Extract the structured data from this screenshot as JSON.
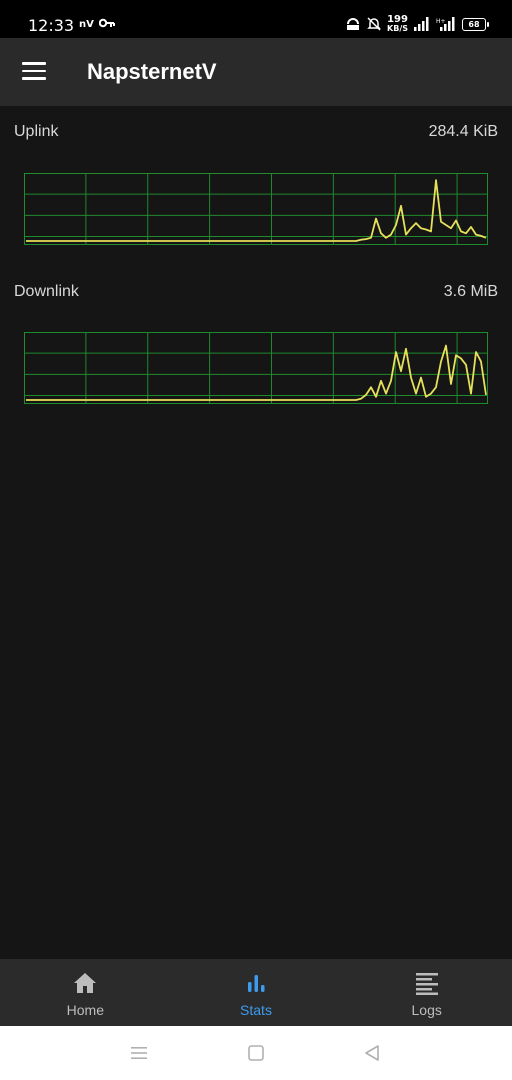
{
  "status_bar": {
    "time": "12:33",
    "nv": "nV",
    "net_speed_value": "199",
    "net_speed_unit": "KB/S",
    "battery": "68",
    "icons": [
      "key-icon",
      "vpn-icon",
      "mute-icon",
      "signal-icon",
      "signal-hplus-icon",
      "battery-icon"
    ]
  },
  "app_bar": {
    "title": "NapsternetV",
    "menu_icon": "hamburger-menu-icon"
  },
  "stats": {
    "uplink": {
      "label": "Uplink",
      "value": "284.4 KiB"
    },
    "downlink": {
      "label": "Downlink",
      "value": "3.6 MiB"
    }
  },
  "chart_data": [
    {
      "type": "line",
      "title": "Uplink",
      "values": [
        0,
        0,
        0,
        0,
        0,
        0,
        0,
        0,
        0,
        0,
        0,
        0,
        0,
        0,
        0,
        0,
        0,
        0,
        0,
        0,
        0,
        0,
        0,
        0,
        0,
        0,
        0,
        0,
        0,
        0,
        0,
        0,
        0,
        0,
        0,
        0,
        0,
        0,
        0,
        0,
        0,
        0,
        0,
        0,
        0,
        0,
        0,
        0,
        0,
        0,
        0,
        0,
        0,
        0,
        0,
        0,
        0,
        0,
        0,
        0,
        0,
        0,
        0,
        0,
        0,
        0,
        0,
        0.02,
        0.03,
        0.05,
        0.35,
        0.12,
        0.05,
        0.1,
        0.25,
        0.55,
        0.1,
        0.2,
        0.28,
        0.2,
        0.18,
        0.15,
        0.95,
        0.3,
        0.25,
        0.2,
        0.32,
        0.15,
        0.12,
        0.22,
        0.1,
        0.08,
        0.05
      ],
      "grid": true,
      "color": "#e6e05a",
      "grid_color": "#1f8a2e"
    },
    {
      "type": "line",
      "title": "Downlink",
      "values": [
        0,
        0,
        0,
        0,
        0,
        0,
        0,
        0,
        0,
        0,
        0,
        0,
        0,
        0,
        0,
        0,
        0,
        0,
        0,
        0,
        0,
        0,
        0,
        0,
        0,
        0,
        0,
        0,
        0,
        0,
        0,
        0,
        0,
        0,
        0,
        0,
        0,
        0,
        0,
        0,
        0,
        0,
        0,
        0,
        0,
        0,
        0,
        0,
        0,
        0,
        0,
        0,
        0,
        0,
        0,
        0,
        0,
        0,
        0,
        0,
        0,
        0,
        0,
        0,
        0,
        0,
        0,
        0.02,
        0.08,
        0.2,
        0.05,
        0.3,
        0.1,
        0.3,
        0.75,
        0.45,
        0.8,
        0.35,
        0.1,
        0.35,
        0.05,
        0.1,
        0.2,
        0.6,
        0.85,
        0.25,
        0.7,
        0.65,
        0.55,
        0.1,
        0.75,
        0.6,
        0.08
      ],
      "grid": true,
      "color": "#e6e05a",
      "grid_color": "#1f8a2e"
    }
  ],
  "bottom_nav": {
    "items": [
      {
        "label": "Home",
        "icon": "home-icon",
        "active": false
      },
      {
        "label": "Stats",
        "icon": "stats-icon",
        "active": true
      },
      {
        "label": "Logs",
        "icon": "logs-icon",
        "active": false
      }
    ]
  },
  "system_nav": {
    "icons": [
      "recents-icon",
      "home-square-icon",
      "back-icon"
    ]
  },
  "colors": {
    "background": "#151515",
    "app_bar": "#2a2a2a",
    "accent": "#3d9bf0",
    "line": "#e6e05a",
    "grid": "#1f8a2e"
  }
}
